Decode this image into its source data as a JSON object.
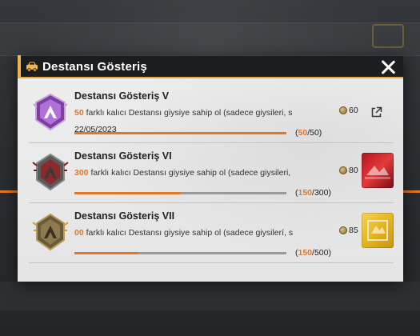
{
  "dialog": {
    "title": "Destansı Gösteriş"
  },
  "colors": {
    "accent": "#e0782a",
    "header_accent": "#f2b34a",
    "header_bg": "#1c1d1f"
  },
  "achievements": [
    {
      "title": "Destansı Gösteriş V",
      "desc_num": "50",
      "desc_text": " farklı kalıcı Destansı giysiye sahip ol (sadece giysileri, s",
      "date": "22/05/2023",
      "progress_current": "50",
      "progress_total": "50",
      "progress_open": "(",
      "progress_sep": "/",
      "progress_close": ")",
      "progress_fraction": 1.0,
      "reward_amount": "60",
      "badge_color": "purple",
      "action": "share-icon"
    },
    {
      "title": "Destansı Gösteriş VI",
      "desc_num": "300",
      "desc_text": " farklı kalıcı Destansı giysiye sahip ol (sadece giysileri,",
      "progress_current": "150",
      "progress_total": "300",
      "progress_open": "(",
      "progress_sep": "/",
      "progress_close": ")",
      "progress_fraction": 0.5,
      "reward_amount": "80",
      "badge_color": "red",
      "action": "red-item-thumbnail"
    },
    {
      "title": "Destansı Gösteriş VII",
      "desc_num": "00",
      "desc_text": " farklı kalıcı Destansı giysiye sahip ol (sadece giysilerí, s",
      "progress_current": "150",
      "progress_total": "500",
      "progress_open": "(",
      "progress_sep": "/",
      "progress_close": ")",
      "progress_fraction": 0.3,
      "reward_amount": "85",
      "badge_color": "gold",
      "action": "gold-item-thumbnail"
    }
  ]
}
